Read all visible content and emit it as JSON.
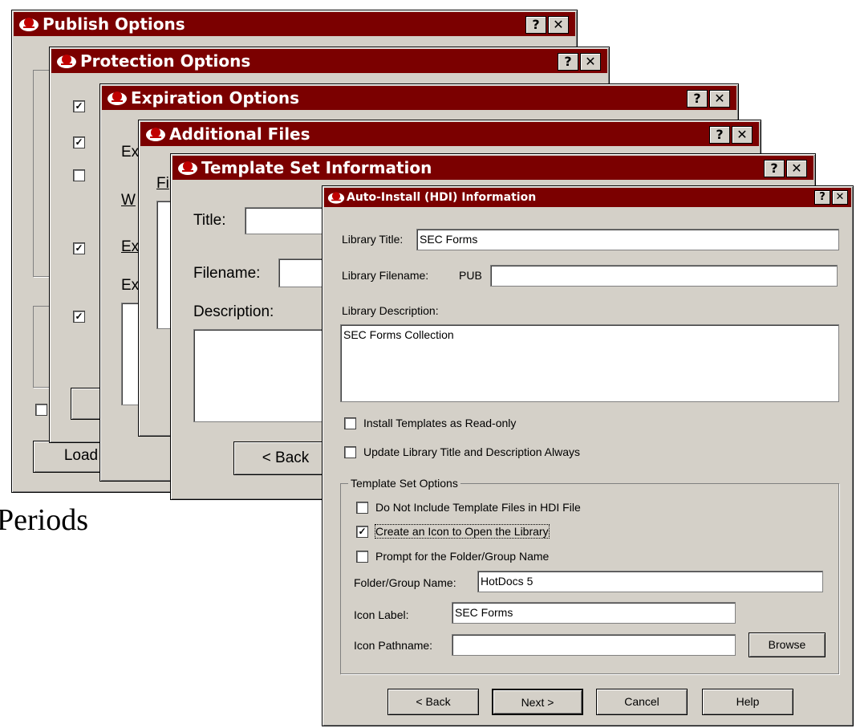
{
  "background_text": "Periods",
  "windows": {
    "publish": {
      "title": "Publish Options",
      "load_button": "Load"
    },
    "protection": {
      "title": "Protection Options"
    },
    "expiration": {
      "title": "Expiration Options",
      "label_ex1": "Ex",
      "label_w": "W",
      "label_ex2": "Ex",
      "label_ex3": "Ex"
    },
    "additional_files": {
      "title": "Additional Files",
      "label_fi": "Fi"
    },
    "template_set": {
      "title": "Template Set Information",
      "title_label": "Title:",
      "filename_label": "Filename:",
      "description_label": "Description:",
      "back_button": "< Back"
    },
    "auto_install": {
      "title": "Auto-Install (HDI) Information",
      "library_title_label": "Library Title:",
      "library_title_value": "SEC Forms",
      "library_filename_label": "Library Filename:",
      "library_filename_prefix": "PUB",
      "library_filename_value": "",
      "library_description_label": "Library Description:",
      "library_description_value": "SEC Forms Collection",
      "install_readonly_label": "Install Templates as Read-only",
      "install_readonly_checked": false,
      "update_library_label": "Update Library Title and Description Always",
      "update_library_checked": false,
      "group_title": "Template Set Options",
      "do_not_include_label": "Do Not Include Template Files in HDI File",
      "do_not_include_checked": false,
      "create_icon_label": "Create an Icon to Open the Library",
      "create_icon_checked": true,
      "prompt_folder_label": "Prompt for the Folder/Group Name",
      "prompt_folder_checked": false,
      "folder_group_label": "Folder/Group Name:",
      "folder_group_value": "HotDocs 5",
      "icon_label_label": "Icon Label:",
      "icon_label_value": "SEC Forms",
      "icon_pathname_label": "Icon Pathname:",
      "icon_pathname_value": "",
      "browse_button": "Browse",
      "back_button": "< Back",
      "next_button": "Next >",
      "cancel_button": "Cancel",
      "help_button": "Help"
    }
  },
  "titlebar_buttons": {
    "help": "?",
    "close": "✕"
  },
  "colors": {
    "titlebar": "#7b0000",
    "dialog_face": "#d4d0c8"
  }
}
